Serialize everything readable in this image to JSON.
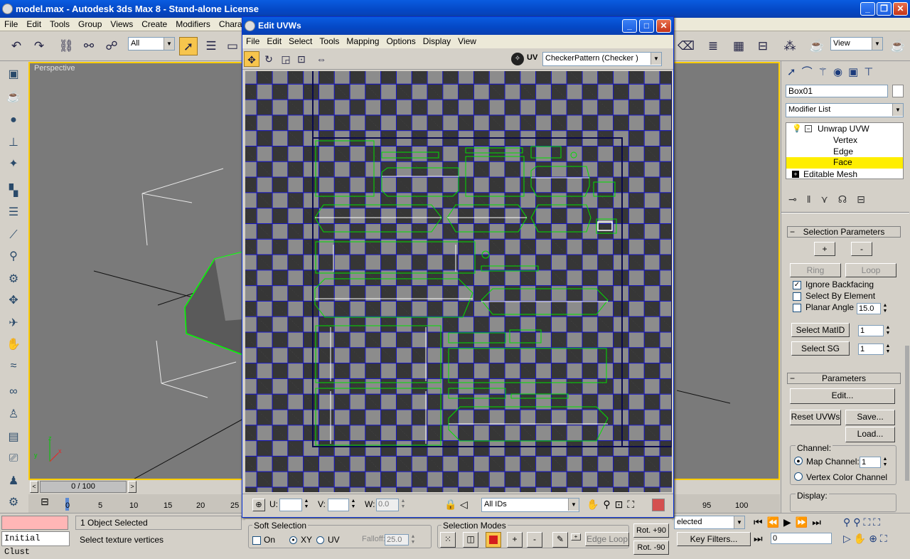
{
  "app": {
    "title": "model.max - Autodesk 3ds Max 8 - Stand-alone License",
    "menu": [
      "File",
      "Edit",
      "Tools",
      "Group",
      "Views",
      "Create",
      "Modifiers",
      "Character"
    ],
    "selection_filter": "All",
    "view_combo": "View"
  },
  "viewport": {
    "label": "Perspective",
    "time_slider": "0 / 100",
    "ruler_ticks": [
      "0",
      "5",
      "10",
      "15",
      "20",
      "25"
    ],
    "ruler_ticks_right": [
      "95",
      "100"
    ]
  },
  "status": {
    "selected": "1 Object Selected",
    "prompt": "Select texture vertices",
    "script": "Initial Clust",
    "selected_combo": "elected",
    "key_filters": "Key Filters...",
    "frame": "0"
  },
  "uv_editor": {
    "title": "Edit UVWs",
    "menu": [
      "File",
      "Edit",
      "Select",
      "Tools",
      "Mapping",
      "Options",
      "Display",
      "View"
    ],
    "uv_label": "UV",
    "texture": "CheckerPattern  (Checker )",
    "u_label": "U:",
    "v_label": "V:",
    "w_label": "W:",
    "w_value": "0.0",
    "ids": "All IDs"
  },
  "soft_selection": {
    "title": "Soft Selection",
    "on": "On",
    "xy": "XY",
    "uv": "UV",
    "falloff_label": "Falloff:",
    "falloff": "25.0"
  },
  "selection_modes": {
    "title": "Selection Modes",
    "edge_loop": "Edge Loop",
    "plus": "+",
    "minus": "-"
  },
  "rot": {
    "pos90": "Rot. +90",
    "neg90": "Rot. -90"
  },
  "command_panel": {
    "object_name": "Box01",
    "modifier_list": "Modifier List",
    "stack": [
      {
        "label": "Unwrap UVW",
        "level": 0
      },
      {
        "label": "Vertex",
        "level": 1
      },
      {
        "label": "Edge",
        "level": 1
      },
      {
        "label": "Face",
        "level": 1,
        "selected": true
      },
      {
        "label": "Editable Mesh",
        "level": 0
      }
    ],
    "selection_parameters": {
      "title": "Selection Parameters",
      "plus": "+",
      "minus": "-",
      "ring": "Ring",
      "loop": "Loop",
      "ignore_backfacing": "Ignore Backfacing",
      "select_by_element": "Select By Element",
      "planar_angle": "Planar Angle",
      "planar_value": "15.0",
      "select_matid": "Select MatID",
      "matid_value": "1",
      "select_sg": "Select SG",
      "sg_value": "1"
    },
    "parameters": {
      "title": "Parameters",
      "edit": "Edit...",
      "reset": "Reset UVWs",
      "save": "Save...",
      "load": "Load...",
      "channel": "Channel:",
      "map_channel": "Map Channel:",
      "map_value": "1",
      "vertex_color": "Vertex Color Channel",
      "display": "Display:"
    }
  }
}
